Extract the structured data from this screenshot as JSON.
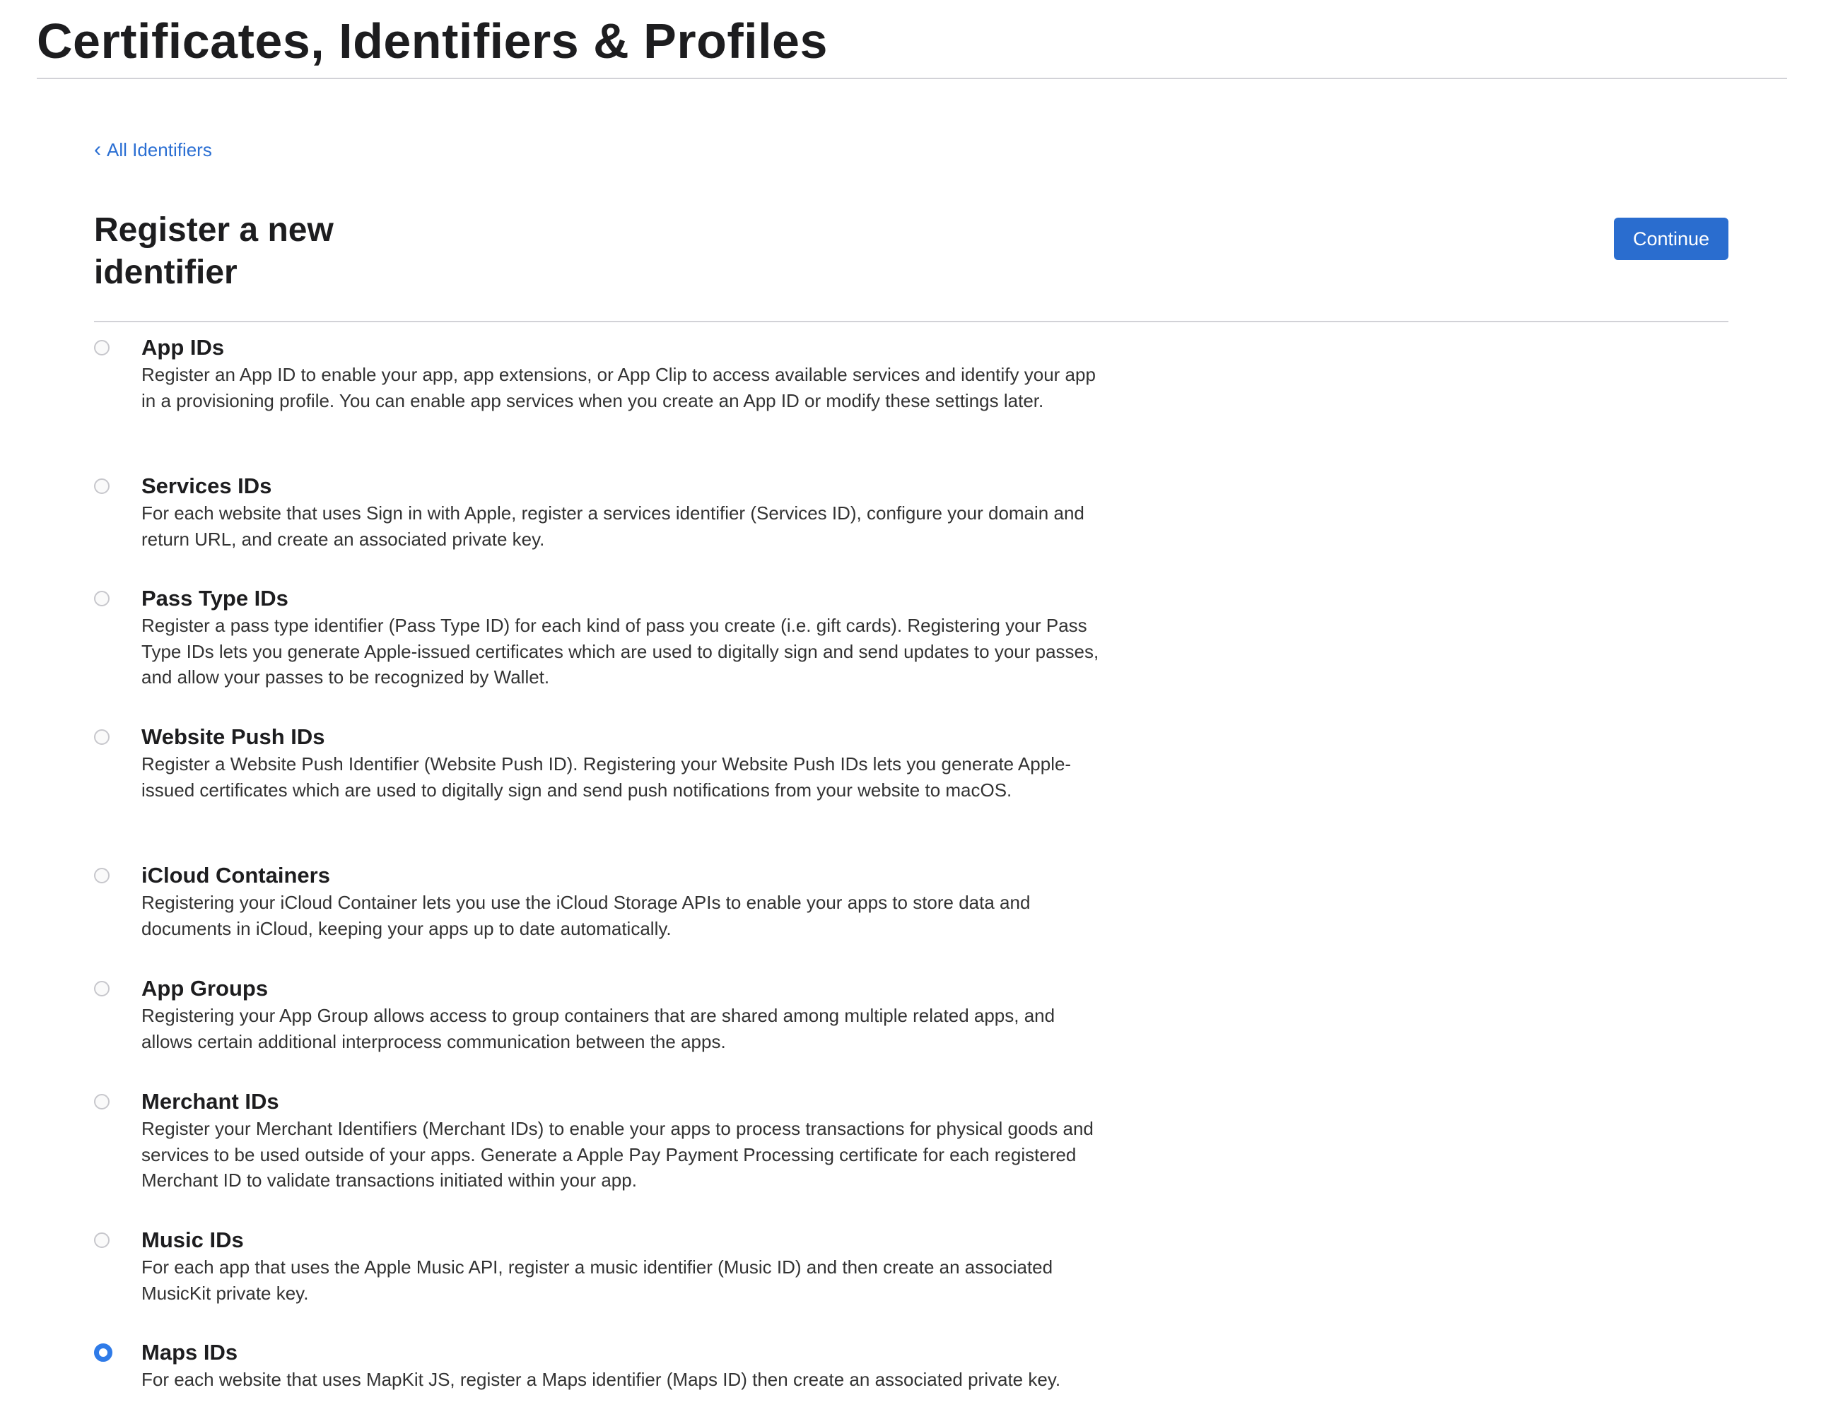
{
  "header": {
    "title": "Certificates, Identifiers & Profiles"
  },
  "nav": {
    "back_label": "All Identifiers",
    "back_chevron": "‹"
  },
  "section": {
    "title": "Register a new identifier",
    "continue_label": "Continue"
  },
  "options": [
    {
      "title": "App IDs",
      "description": "Register an App ID to enable your app, app extensions, or App Clip to access available services and identify your app in a provisioning profile. You can enable app services when you create an App ID or modify these settings later.",
      "selected": false
    },
    {
      "title": "Services IDs",
      "description": "For each website that uses Sign in with Apple, register a services identifier (Services ID), configure your domain and return URL, and create an associated private key.",
      "selected": false
    },
    {
      "title": "Pass Type IDs",
      "description": "Register a pass type identifier (Pass Type ID) for each kind of pass you create (i.e. gift cards). Registering your Pass Type IDs lets you generate Apple-issued certificates which are used to digitally sign and send updates to your passes, and allow your passes to be recognized by Wallet.",
      "selected": false
    },
    {
      "title": "Website Push IDs",
      "description": "Register a Website Push Identifier (Website Push ID). Registering your Website Push IDs lets you generate Apple-issued certificates which are used to digitally sign and send push notifications from your website to macOS.",
      "selected": false
    },
    {
      "title": "iCloud Containers",
      "description": "Registering your iCloud Container lets you use the iCloud Storage APIs to enable your apps to store data and documents in iCloud, keeping your apps up to date automatically.",
      "selected": false
    },
    {
      "title": "App Groups",
      "description": "Registering your App Group allows access to group containers that are shared among multiple related apps, and allows certain additional interprocess communication between the apps.",
      "selected": false
    },
    {
      "title": "Merchant IDs",
      "description": "Register your Merchant Identifiers (Merchant IDs) to enable your apps to process transactions for physical goods and services to be used outside of your apps. Generate a Apple Pay Payment Processing certificate for each registered Merchant ID to validate transactions initiated within your app.",
      "selected": false
    },
    {
      "title": "Music IDs",
      "description": "For each app that uses the Apple Music API, register a music identifier (Music ID) and then create an associated MusicKit private key.",
      "selected": false
    },
    {
      "title": "Maps IDs",
      "description": "For each website that uses MapKit JS, register a Maps identifier (Maps ID) then create an associated private key.",
      "selected": true
    }
  ],
  "colors": {
    "accent": "#2a6dcf",
    "link": "#2b6fd3",
    "radio_selected": "#2f7be8",
    "divider": "#d2d2d7"
  }
}
